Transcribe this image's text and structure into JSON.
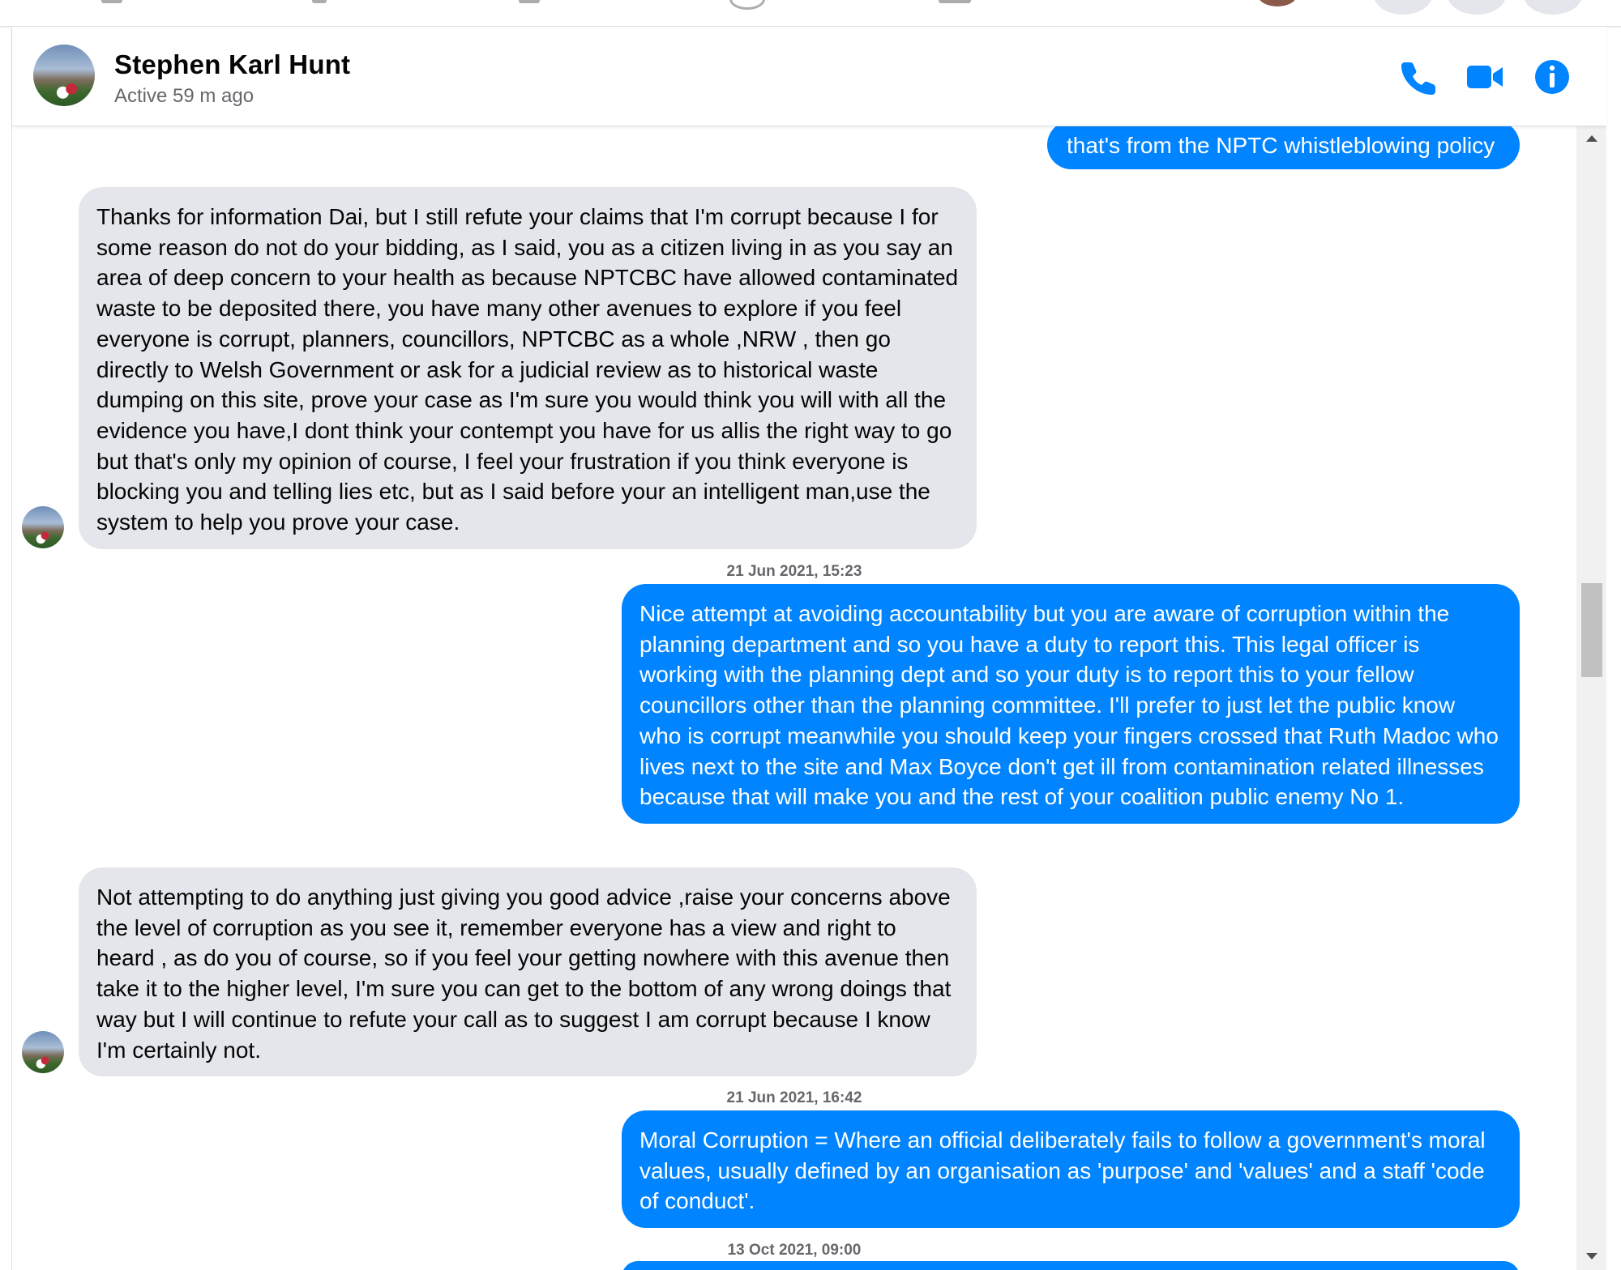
{
  "header": {
    "contact_name": "Stephen Karl Hunt",
    "status": "Active 59 m ago"
  },
  "colors": {
    "accent": "#0084ff",
    "incoming_bubble": "#e4e6eb",
    "timestamp_text": "#65676b"
  },
  "icons": {
    "call": "phone-icon",
    "video": "video-camera-icon",
    "info": "info-icon"
  },
  "messages": [
    {
      "direction": "outgoing",
      "text": "that's from the NPTC whistleblowing policy"
    },
    {
      "direction": "incoming",
      "text": "Thanks for information Dai, but I still refute your claims that I'm corrupt because I for some reason do not do your bidding, as I said,  you as a citizen living in as you say an area of deep concern to your health as because NPTCBC have allowed contaminated waste to be deposited there, you have many other avenues to explore if you feel everyone is corrupt, planners, councillors, NPTCBC as a whole ,NRW , then go directly to Welsh Government or ask for a judicial review as to historical waste dumping on this site,  prove your case as I'm sure you would think you will with all the evidence you have,I dont think your contempt you have for us allis the right way to go but that's only my opinion of course,  I feel your frustration if you think everyone is blocking you and telling lies etc, but as I said before your an intelligent man,use the system to help you prove your case."
    },
    {
      "timestamp": "21 Jun 2021, 15:23"
    },
    {
      "direction": "outgoing",
      "text": "Nice attempt at avoiding accountability but you are aware of corruption within the planning department and so you have a duty to report this. This legal officer is working with the planning dept and so your duty is to report this to your fellow councillors other than the planning committee. I'll prefer to just let the public know who is corrupt meanwhile you should keep your fingers crossed that Ruth Madoc who lives next to the site and Max Boyce don't get ill from contamination related illnesses because that will make you and the rest of your coalition public enemy No 1."
    },
    {
      "direction": "incoming",
      "text": "Not attempting to do anything just giving you good advice ,raise your concerns above the level of corruption as you see it, remember everyone has a view and right to heard , as do you of course, so if you feel your getting nowhere with this avenue then take it to the higher level, I'm sure you can get to the bottom of any wrong doings that way but I will continue to refute your call as to suggest I am corrupt because I know I'm certainly not."
    },
    {
      "timestamp": "21 Jun 2021, 16:42"
    },
    {
      "direction": "outgoing",
      "text": "Moral Corruption = Where an official deliberately fails to follow a government's moral values, usually defined by an organisation as 'purpose' and 'values' and a staff 'code of conduct'."
    },
    {
      "timestamp": "13 Oct 2021, 09:00"
    }
  ]
}
